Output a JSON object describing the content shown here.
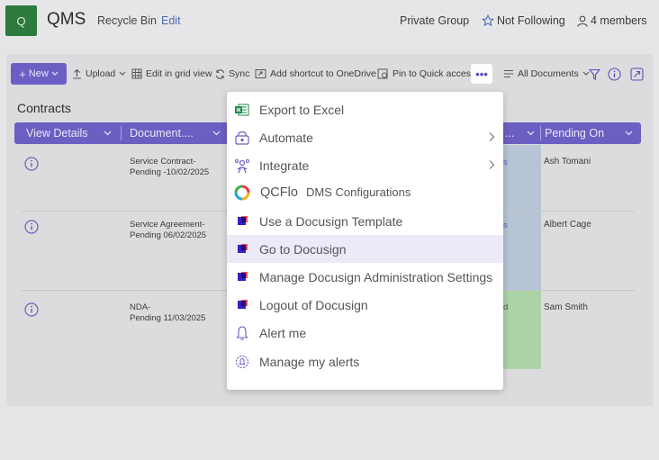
{
  "header": {
    "logo_letter": "Q",
    "site_title": "QMS",
    "recycle_bin": "Recycle Bin",
    "edit": "Edit",
    "group": "Private Group",
    "follow": "Not Following",
    "members": "4 members"
  },
  "commandbar": {
    "new": "New",
    "upload": "Upload",
    "edit_grid": "Edit in grid view",
    "sync": "Sync",
    "shortcut": "Add shortcut to OneDrive",
    "pin": "Pin to Quick access",
    "more": "•••",
    "view": "All Documents"
  },
  "list": {
    "title": "Contracts",
    "columns": {
      "view_details": "View Details",
      "document": "Document....",
      "status_partial": "...",
      "pending_on": "Pending On"
    },
    "rows": [
      {
        "doc_line1": "Service Contract-",
        "doc_line2": "Pending -10/02/2025",
        "status_partial": "s",
        "pending_on": "Ash Tomani"
      },
      {
        "doc_line1": "Service Agreement-",
        "doc_line2": "Pending 06/02/2025",
        "status_partial": "s",
        "pending_on": "Albert Cage"
      },
      {
        "doc_line1": "NDA-",
        "doc_line2": "Pending 11/03/2025",
        "status_partial": "d",
        "pending_on": "Sam Smith"
      }
    ]
  },
  "menu": {
    "items": [
      {
        "label": "Export to Excel",
        "icon": "excel-icon"
      },
      {
        "label": "Automate",
        "icon": "automate-icon"
      },
      {
        "label": "Integrate",
        "icon": "integrate-icon"
      },
      {
        "label_brand": "QCFlo",
        "label": "DMS Configurations",
        "icon": "qcflo-icon"
      },
      {
        "label": "Use a Docusign Template",
        "icon": "docusign-icon"
      },
      {
        "label": "Go to Docusign",
        "icon": "docusign-icon"
      },
      {
        "label": "Manage Docusign Administration Settings",
        "icon": "docusign-icon"
      },
      {
        "label": "Logout of Docusign",
        "icon": "docusign-icon"
      },
      {
        "label": "Alert me",
        "icon": "bell-icon"
      },
      {
        "label": "Manage my alerts",
        "icon": "gear-bell-icon"
      }
    ]
  },
  "colors": {
    "accent": "#6b5fc2",
    "logo_bg": "#2c7a3d",
    "status_blue": "#b6c4d6",
    "status_green": "#acd3a6",
    "menu_highlight": "#edeaf8"
  }
}
